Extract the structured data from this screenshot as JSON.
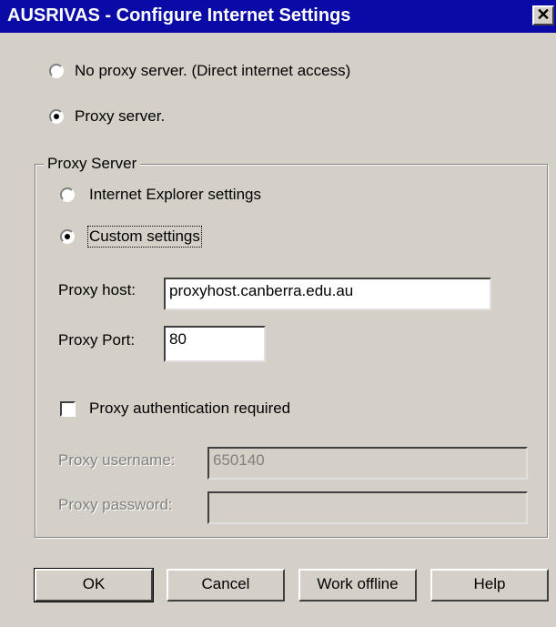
{
  "window": {
    "title": "AUSRIVAS - Configure Internet Settings",
    "close_glyph": "✕"
  },
  "connection": {
    "no_proxy_label": "No proxy server. (Direct internet access)",
    "proxy_label": "Proxy server.",
    "selected": "proxy"
  },
  "proxy_server": {
    "group_title": "Proxy Server",
    "ie_label": "Internet Explorer settings",
    "custom_label": "Custom settings",
    "selected": "custom",
    "host_label": "Proxy host:",
    "host_value": "proxyhost.canberra.edu.au",
    "port_label": "Proxy Port:",
    "port_value": "80",
    "auth_label": "Proxy authentication required",
    "auth_checked": false,
    "username_label": "Proxy username:",
    "username_value": "650140",
    "password_label": "Proxy password:",
    "password_value": ""
  },
  "buttons": {
    "ok": "OK",
    "cancel": "Cancel",
    "work_offline": "Work offline",
    "help": "Help"
  },
  "colors": {
    "titlebar": "#0a0aa6",
    "dialog_bg": "#d4d0c8"
  }
}
